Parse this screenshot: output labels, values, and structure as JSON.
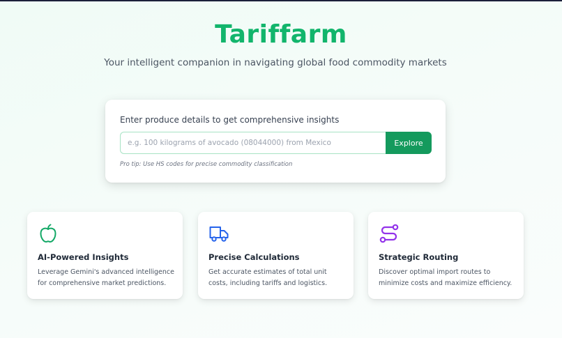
{
  "header": {
    "brand": "Tariffarm",
    "tagline": "Your intelligent companion in navigating global food commodity markets"
  },
  "search": {
    "prompt": "Enter produce details to get comprehensive insights",
    "placeholder": "e.g. 100 kilograms of avocado (08044000) from Mexico",
    "value": "",
    "button_label": "Explore",
    "protip": "Pro tip: Use HS codes for precise commodity classification"
  },
  "features": [
    {
      "icon": "apple-icon",
      "icon_color": "#12a866",
      "title": "AI-Powered Insights",
      "description": "Leverage Gemini's advanced intelligence for comprehensive market predictions."
    },
    {
      "icon": "truck-icon",
      "icon_color": "#2563eb",
      "title": "Precise Calculations",
      "description": "Get accurate estimates of total unit costs, including tariffs and logistics."
    },
    {
      "icon": "route-icon",
      "icon_color": "#9333ea",
      "title": "Strategic Routing",
      "description": "Discover optimal import routes to minimize costs and maximize efficiency."
    }
  ],
  "colors": {
    "brand": "#12b56c",
    "button": "#149a5d",
    "input_border": "#a7e3c4"
  }
}
